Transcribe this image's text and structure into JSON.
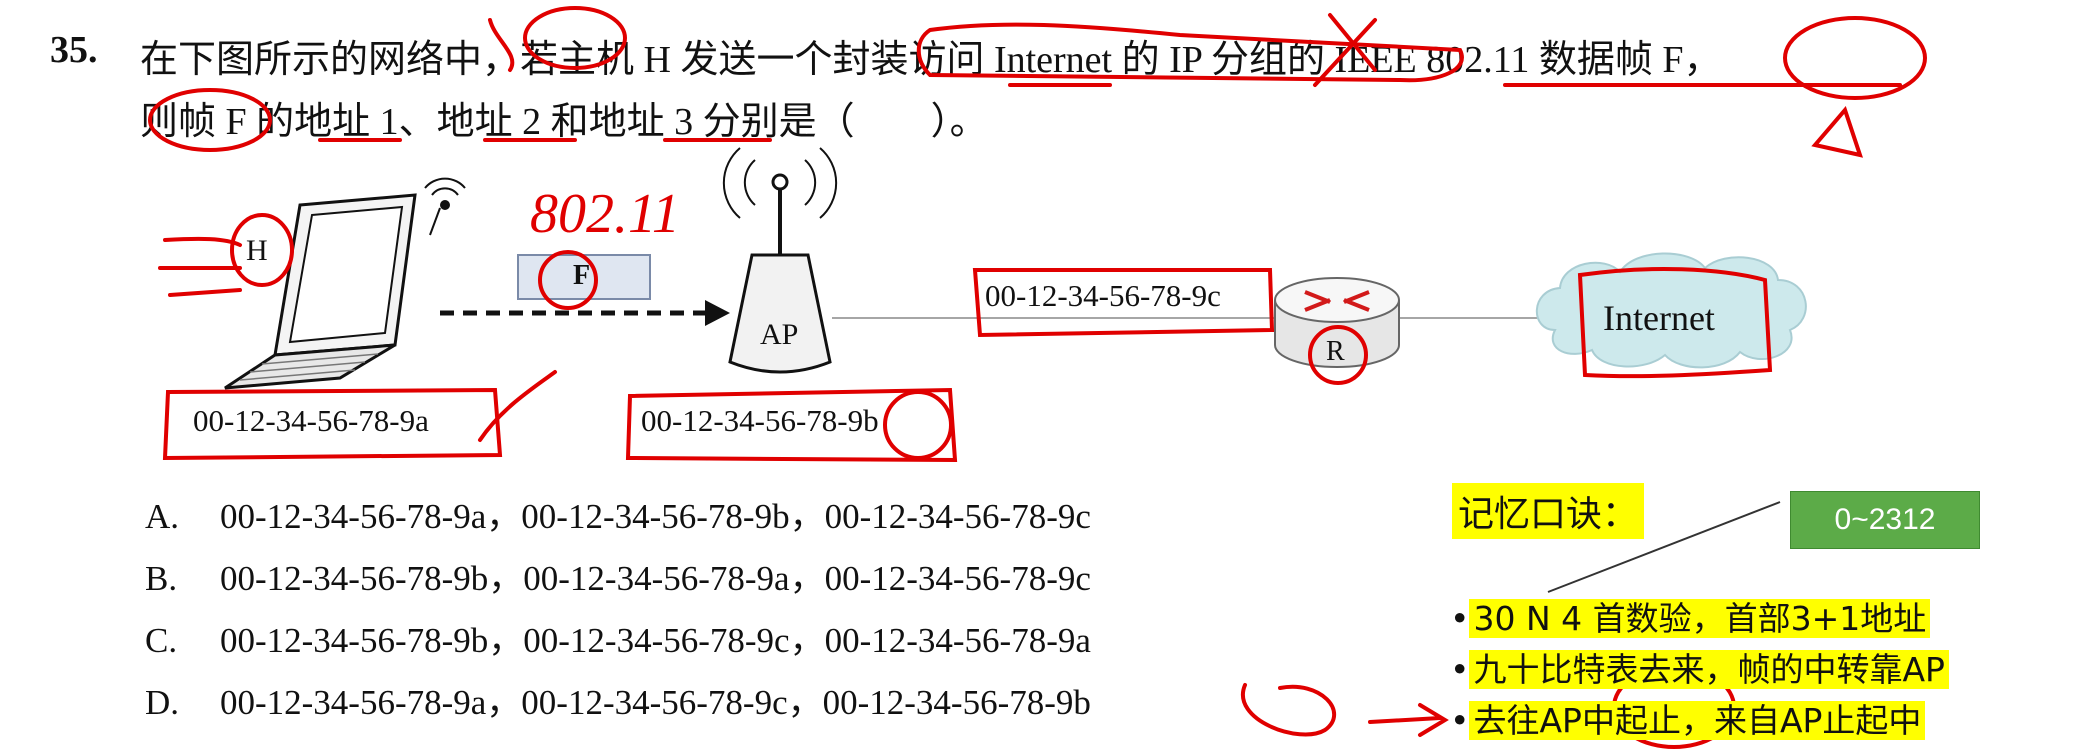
{
  "question": {
    "number": "35.",
    "line1": "在下图所示的网络中，若主机 H 发送一个封装访问 Internet 的 IP 分组的 IEEE 802.11 数据帧 F，",
    "line2": "则帧 F 的地址 1、地址 2 和地址 3 分别是（　　）。"
  },
  "diagram": {
    "host_label": "H",
    "frame_label": "F",
    "ap_label": "AP",
    "router_label": "R",
    "internet_label": "Internet",
    "host_mac": "00-12-34-56-78-9a",
    "ap_mac": "00-12-34-56-78-9b",
    "router_mac": "00-12-34-56-78-9c",
    "handwritten_note": "802.11"
  },
  "options": [
    {
      "letter": "A.",
      "text": "00-12-34-56-78-9a，00-12-34-56-78-9b，00-12-34-56-78-9c"
    },
    {
      "letter": "B.",
      "text": "00-12-34-56-78-9b，00-12-34-56-78-9a，00-12-34-56-78-9c"
    },
    {
      "letter": "C.",
      "text": "00-12-34-56-78-9b，00-12-34-56-78-9c，00-12-34-56-78-9a"
    },
    {
      "letter": "D.",
      "text": "00-12-34-56-78-9a，00-12-34-56-78-9c，00-12-34-56-78-9b"
    }
  ],
  "mnemonic": {
    "title": "记忆口诀：",
    "range_box": "0~2312",
    "lines": [
      "30 N 4 首数验，首部3+1地址",
      "九十比特表去来，帧的中转靠AP",
      "去往AP中起止，来自AP止起中"
    ]
  },
  "colors": {
    "ink_red": "#e00000",
    "highlight": "#ffff00",
    "range_green": "#5cab48"
  }
}
